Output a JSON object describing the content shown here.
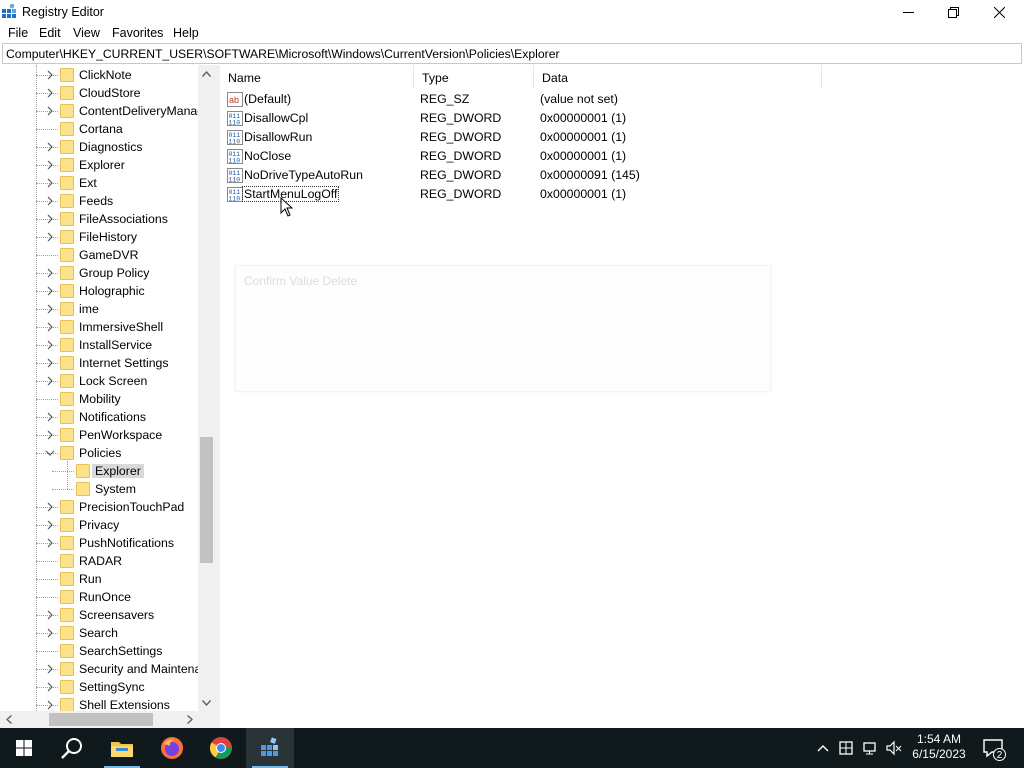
{
  "window": {
    "title": "Registry Editor",
    "icon": "regedit-icon"
  },
  "menu": [
    "File",
    "Edit",
    "View",
    "Favorites",
    "Help"
  ],
  "address": "Computer\\HKEY_CURRENT_USER\\SOFTWARE\\Microsoft\\Windows\\CurrentVersion\\Policies\\Explorer",
  "tree": {
    "items": [
      {
        "label": "ClickNote",
        "expandable": true
      },
      {
        "label": "CloudStore",
        "expandable": true
      },
      {
        "label": "ContentDeliveryManag",
        "expandable": true
      },
      {
        "label": "Cortana",
        "expandable": false
      },
      {
        "label": "Diagnostics",
        "expandable": true
      },
      {
        "label": "Explorer",
        "expandable": true
      },
      {
        "label": "Ext",
        "expandable": true
      },
      {
        "label": "Feeds",
        "expandable": true
      },
      {
        "label": "FileAssociations",
        "expandable": true
      },
      {
        "label": "FileHistory",
        "expandable": true
      },
      {
        "label": "GameDVR",
        "expandable": false
      },
      {
        "label": "Group Policy",
        "expandable": true
      },
      {
        "label": "Holographic",
        "expandable": true
      },
      {
        "label": "ime",
        "expandable": true
      },
      {
        "label": "ImmersiveShell",
        "expandable": true
      },
      {
        "label": "InstallService",
        "expandable": true
      },
      {
        "label": "Internet Settings",
        "expandable": true
      },
      {
        "label": "Lock Screen",
        "expandable": true
      },
      {
        "label": "Mobility",
        "expandable": false
      },
      {
        "label": "Notifications",
        "expandable": true
      },
      {
        "label": "PenWorkspace",
        "expandable": true
      },
      {
        "label": "Policies",
        "expandable": true,
        "expanded": true
      },
      {
        "label": "Explorer",
        "child": true,
        "selected": true
      },
      {
        "label": "System",
        "child": true
      },
      {
        "label": "PrecisionTouchPad",
        "expandable": true
      },
      {
        "label": "Privacy",
        "expandable": true
      },
      {
        "label": "PushNotifications",
        "expandable": true
      },
      {
        "label": "RADAR",
        "expandable": false
      },
      {
        "label": "Run",
        "expandable": false
      },
      {
        "label": "RunOnce",
        "expandable": false
      },
      {
        "label": "Screensavers",
        "expandable": true
      },
      {
        "label": "Search",
        "expandable": true
      },
      {
        "label": "SearchSettings",
        "expandable": false
      },
      {
        "label": "Security and Maintena",
        "expandable": true
      },
      {
        "label": "SettingSync",
        "expandable": true
      },
      {
        "label": "Shell Extensions",
        "expandable": true
      }
    ]
  },
  "values": {
    "columns": {
      "name": "Name",
      "type": "Type",
      "data": "Data"
    },
    "rows": [
      {
        "name": "(Default)",
        "type": "REG_SZ",
        "data": "(value not set)",
        "icon": "string-value-icon"
      },
      {
        "name": "DisallowCpl",
        "type": "REG_DWORD",
        "data": "0x00000001 (1)",
        "icon": "binary-value-icon"
      },
      {
        "name": "DisallowRun",
        "type": "REG_DWORD",
        "data": "0x00000001 (1)",
        "icon": "binary-value-icon"
      },
      {
        "name": "NoClose",
        "type": "REG_DWORD",
        "data": "0x00000001 (1)",
        "icon": "binary-value-icon"
      },
      {
        "name": "NoDriveTypeAutoRun",
        "type": "REG_DWORD",
        "data": "0x00000091 (145)",
        "icon": "binary-value-icon"
      },
      {
        "name": "StartMenuLogOff",
        "type": "REG_DWORD",
        "data": "0x00000001 (1)",
        "icon": "binary-value-icon",
        "focused": true
      }
    ]
  },
  "dialog": {
    "title": "Confirm Value Delete"
  },
  "taskbar": {
    "apps": [
      "start-icon",
      "search-icon",
      "file-explorer-icon",
      "firefox-icon",
      "chrome-icon",
      "regedit-icon"
    ],
    "active_app": "regedit-icon",
    "time": "1:54 AM",
    "date": "6/15/2023",
    "notification_count": "2"
  },
  "colors": {
    "taskbar": "#101a1c",
    "folder": "#fce28a",
    "selection": "#d9d9d9"
  }
}
